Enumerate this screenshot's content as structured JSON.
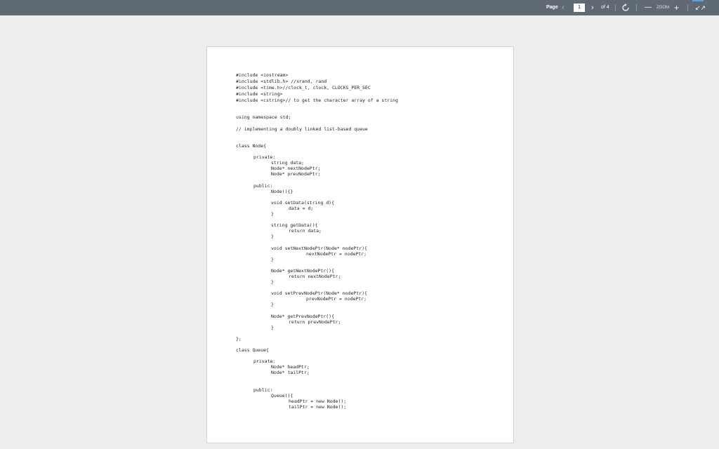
{
  "toolbar": {
    "page_label": "Page",
    "prev_icon": "chevron-left-icon",
    "current_page": "1",
    "next_icon": "chevron-right-icon",
    "of_total": "of 4",
    "rotate_icon": "rotate-icon",
    "zoom_out": "—",
    "zoom_label": "ZOOM",
    "zoom_in": "+",
    "collapse_icon": "collapse-icon",
    "collapse_glyph": "↙↗"
  },
  "document": {
    "lines": [
      "#include <iostream>",
      "#include <stdlib.h> //srand, rand",
      "#include <time.h>//clock_t, clock, CLOCKS_PER_SEC",
      "#include <string>",
      "#include <cstring>// to get the character array of a string",
      "using namespace std;",
      "// implementing a doubly linked list-based queue",
      "class Node{",
      "private:",
      "string data;",
      "Node* nextNodePtr;",
      "Node* prevNodePtr;",
      "public:",
      "Node(){}",
      "void setData(string d){",
      "data = d;",
      "}",
      "string getData(){",
      "return data;",
      "}",
      "void setNextNodePtr(Node* nodePtr){",
      "nextNodePtr = nodePtr;",
      "}",
      "Node* getNextNodePtr(){",
      "return nextNodePtr;",
      "}",
      "void setPrevNodePtr(Node* nodePtr){",
      "prevNodePtr = nodePtr;",
      "}",
      "Node* getPrevNodePtr(){",
      "return prevNodePtr;",
      "}",
      "};",
      "class Queue{",
      "private:",
      "Node* headPtr;",
      "Node* tailPtr;",
      "public:",
      "Queue(){",
      "headPtr = new Node();",
      "tailPtr = new Node();"
    ]
  }
}
